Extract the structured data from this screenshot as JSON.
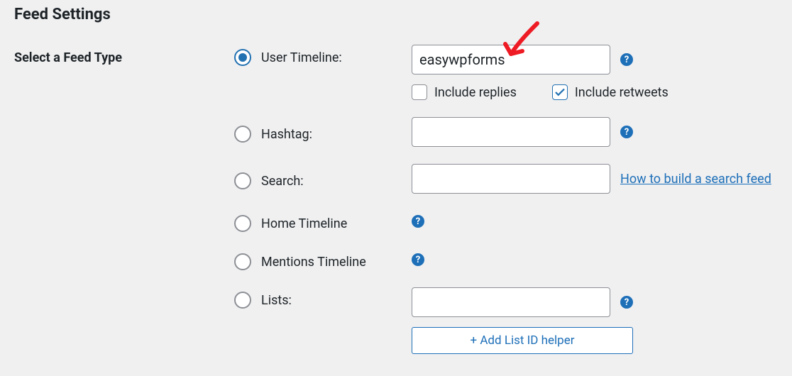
{
  "heading": "Feed Settings",
  "section_label": "Select a Feed Type",
  "options": {
    "user_timeline": {
      "label": "User Timeline:",
      "value": "easywpforms",
      "checked": true,
      "include_replies": {
        "label": "Include replies",
        "checked": false
      },
      "include_retweets": {
        "label": "Include retweets",
        "checked": true
      }
    },
    "hashtag": {
      "label": "Hashtag:",
      "value": "",
      "checked": false
    },
    "search": {
      "label": "Search:",
      "value": "",
      "checked": false,
      "link_text": "How to build a search feed"
    },
    "home": {
      "label": "Home Timeline",
      "checked": false
    },
    "mentions": {
      "label": "Mentions Timeline",
      "checked": false
    },
    "lists": {
      "label": "Lists:",
      "value": "",
      "checked": false,
      "helper_btn": "+ Add List ID helper"
    }
  }
}
